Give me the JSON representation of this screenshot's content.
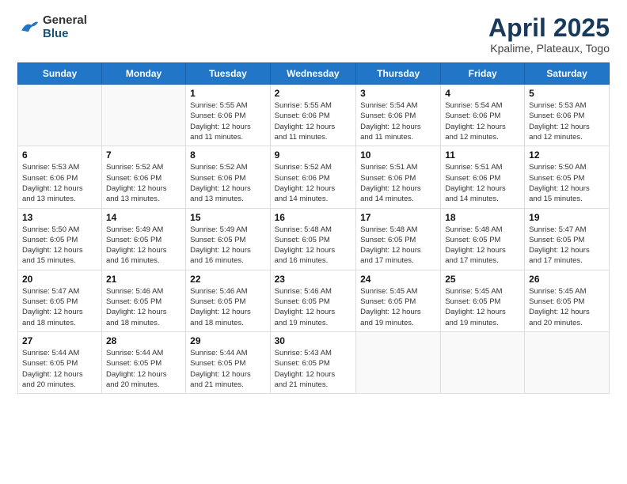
{
  "header": {
    "logo_general": "General",
    "logo_blue": "Blue",
    "title": "April 2025",
    "subtitle": "Kpalime, Plateaux, Togo"
  },
  "days_of_week": [
    "Sunday",
    "Monday",
    "Tuesday",
    "Wednesday",
    "Thursday",
    "Friday",
    "Saturday"
  ],
  "weeks": [
    [
      {
        "day": "",
        "info": ""
      },
      {
        "day": "",
        "info": ""
      },
      {
        "day": "1",
        "info": "Sunrise: 5:55 AM\nSunset: 6:06 PM\nDaylight: 12 hours\nand 11 minutes."
      },
      {
        "day": "2",
        "info": "Sunrise: 5:55 AM\nSunset: 6:06 PM\nDaylight: 12 hours\nand 11 minutes."
      },
      {
        "day": "3",
        "info": "Sunrise: 5:54 AM\nSunset: 6:06 PM\nDaylight: 12 hours\nand 11 minutes."
      },
      {
        "day": "4",
        "info": "Sunrise: 5:54 AM\nSunset: 6:06 PM\nDaylight: 12 hours\nand 12 minutes."
      },
      {
        "day": "5",
        "info": "Sunrise: 5:53 AM\nSunset: 6:06 PM\nDaylight: 12 hours\nand 12 minutes."
      }
    ],
    [
      {
        "day": "6",
        "info": "Sunrise: 5:53 AM\nSunset: 6:06 PM\nDaylight: 12 hours\nand 13 minutes."
      },
      {
        "day": "7",
        "info": "Sunrise: 5:52 AM\nSunset: 6:06 PM\nDaylight: 12 hours\nand 13 minutes."
      },
      {
        "day": "8",
        "info": "Sunrise: 5:52 AM\nSunset: 6:06 PM\nDaylight: 12 hours\nand 13 minutes."
      },
      {
        "day": "9",
        "info": "Sunrise: 5:52 AM\nSunset: 6:06 PM\nDaylight: 12 hours\nand 14 minutes."
      },
      {
        "day": "10",
        "info": "Sunrise: 5:51 AM\nSunset: 6:06 PM\nDaylight: 12 hours\nand 14 minutes."
      },
      {
        "day": "11",
        "info": "Sunrise: 5:51 AM\nSunset: 6:06 PM\nDaylight: 12 hours\nand 14 minutes."
      },
      {
        "day": "12",
        "info": "Sunrise: 5:50 AM\nSunset: 6:05 PM\nDaylight: 12 hours\nand 15 minutes."
      }
    ],
    [
      {
        "day": "13",
        "info": "Sunrise: 5:50 AM\nSunset: 6:05 PM\nDaylight: 12 hours\nand 15 minutes."
      },
      {
        "day": "14",
        "info": "Sunrise: 5:49 AM\nSunset: 6:05 PM\nDaylight: 12 hours\nand 16 minutes."
      },
      {
        "day": "15",
        "info": "Sunrise: 5:49 AM\nSunset: 6:05 PM\nDaylight: 12 hours\nand 16 minutes."
      },
      {
        "day": "16",
        "info": "Sunrise: 5:48 AM\nSunset: 6:05 PM\nDaylight: 12 hours\nand 16 minutes."
      },
      {
        "day": "17",
        "info": "Sunrise: 5:48 AM\nSunset: 6:05 PM\nDaylight: 12 hours\nand 17 minutes."
      },
      {
        "day": "18",
        "info": "Sunrise: 5:48 AM\nSunset: 6:05 PM\nDaylight: 12 hours\nand 17 minutes."
      },
      {
        "day": "19",
        "info": "Sunrise: 5:47 AM\nSunset: 6:05 PM\nDaylight: 12 hours\nand 17 minutes."
      }
    ],
    [
      {
        "day": "20",
        "info": "Sunrise: 5:47 AM\nSunset: 6:05 PM\nDaylight: 12 hours\nand 18 minutes."
      },
      {
        "day": "21",
        "info": "Sunrise: 5:46 AM\nSunset: 6:05 PM\nDaylight: 12 hours\nand 18 minutes."
      },
      {
        "day": "22",
        "info": "Sunrise: 5:46 AM\nSunset: 6:05 PM\nDaylight: 12 hours\nand 18 minutes."
      },
      {
        "day": "23",
        "info": "Sunrise: 5:46 AM\nSunset: 6:05 PM\nDaylight: 12 hours\nand 19 minutes."
      },
      {
        "day": "24",
        "info": "Sunrise: 5:45 AM\nSunset: 6:05 PM\nDaylight: 12 hours\nand 19 minutes."
      },
      {
        "day": "25",
        "info": "Sunrise: 5:45 AM\nSunset: 6:05 PM\nDaylight: 12 hours\nand 19 minutes."
      },
      {
        "day": "26",
        "info": "Sunrise: 5:45 AM\nSunset: 6:05 PM\nDaylight: 12 hours\nand 20 minutes."
      }
    ],
    [
      {
        "day": "27",
        "info": "Sunrise: 5:44 AM\nSunset: 6:05 PM\nDaylight: 12 hours\nand 20 minutes."
      },
      {
        "day": "28",
        "info": "Sunrise: 5:44 AM\nSunset: 6:05 PM\nDaylight: 12 hours\nand 20 minutes."
      },
      {
        "day": "29",
        "info": "Sunrise: 5:44 AM\nSunset: 6:05 PM\nDaylight: 12 hours\nand 21 minutes."
      },
      {
        "day": "30",
        "info": "Sunrise: 5:43 AM\nSunset: 6:05 PM\nDaylight: 12 hours\nand 21 minutes."
      },
      {
        "day": "",
        "info": ""
      },
      {
        "day": "",
        "info": ""
      },
      {
        "day": "",
        "info": ""
      }
    ]
  ]
}
